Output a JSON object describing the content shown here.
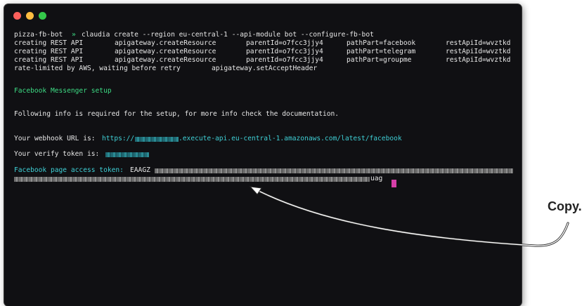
{
  "window": {
    "buttons": [
      "close",
      "minimize",
      "zoom"
    ]
  },
  "terminal": {
    "command": {
      "prompt": "pizza-fb-bot",
      "arrow": "»",
      "text": "claudia create --region eu-central-1 --api-module bot --configure-fb-bot"
    },
    "rows": [
      {
        "col1": "creating REST API",
        "col2": "apigateway.createResource",
        "col3": "parentId=o7fcc3jjy4",
        "col4": "pathPart=facebook",
        "col5": "restApiId=wvztkd"
      },
      {
        "col1": "creating REST API",
        "col2": "apigateway.createResource",
        "col3": "parentId=o7fcc3jjy4",
        "col4": "pathPart=telegram",
        "col5": "restApiId=wvztkd"
      },
      {
        "col1": "creating REST API",
        "col2": "apigateway.createResource",
        "col3": "parentId=o7fcc3jjy4",
        "col4": "pathPart=groupme",
        "col5": "restApiId=wvztkd"
      }
    ],
    "rate_limited": {
      "text": "rate-limited by AWS, waiting before retry",
      "call": "apigateway.setAcceptHeader"
    },
    "setup_heading": "Facebook Messenger setup",
    "info_text": "Following info is required for the setup, for more info check the documentation.",
    "webhook": {
      "label": "Your webhook URL is:",
      "prefix": "https://",
      "suffix": ".execute-api.eu-central-1.amazonaws.com/latest/facebook"
    },
    "verify": {
      "label": "Your verify token is:"
    },
    "token": {
      "label": "Facebook page access token:",
      "start": "EAAGZ",
      "end": "uag"
    }
  },
  "callout": {
    "text": "Copy."
  },
  "colors": {
    "terminal_bg": "#101013",
    "text": "#e7e7e7",
    "green": "#3ddc84",
    "cyan": "#3fd0d6",
    "cursor": "#d63fa8"
  }
}
